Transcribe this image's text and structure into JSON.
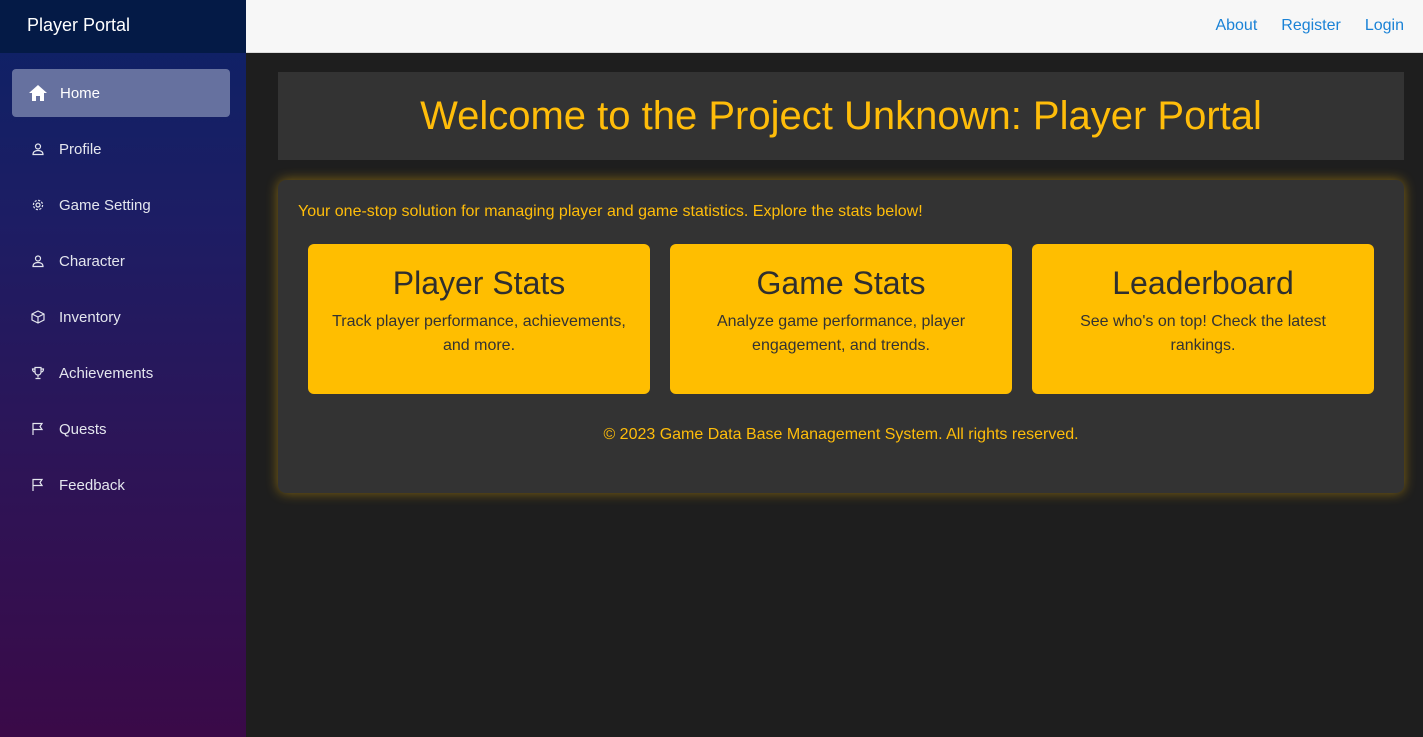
{
  "sidebar": {
    "brand": "Player Portal",
    "items": [
      {
        "label": "Home",
        "icon": "home-icon",
        "active": true
      },
      {
        "label": "Profile",
        "icon": "person-icon"
      },
      {
        "label": "Game Setting",
        "icon": "gear-icon"
      },
      {
        "label": "Character",
        "icon": "person-icon"
      },
      {
        "label": "Inventory",
        "icon": "box-icon"
      },
      {
        "label": "Achievements",
        "icon": "trophy-icon"
      },
      {
        "label": "Quests",
        "icon": "flag-icon"
      },
      {
        "label": "Feedback",
        "icon": "flag-icon"
      }
    ]
  },
  "topbar": {
    "links": [
      "About",
      "Register",
      "Login"
    ]
  },
  "hero": {
    "title": "Welcome to the Project Unknown: Player Portal"
  },
  "main": {
    "intro": "Your one-stop solution for managing player and game statistics. Explore the stats below!",
    "cards": [
      {
        "title": "Player Stats",
        "description": "Track player performance, achievements, and more."
      },
      {
        "title": "Game Stats",
        "description": "Analyze game performance, player engagement, and trends."
      },
      {
        "title": "Leaderboard",
        "description": "See who's on top! Check the latest rankings."
      }
    ],
    "footer": "© 2023 Game Data Base Management System. All rights reserved."
  },
  "colors": {
    "accent": "#ffbe00",
    "link": "#1a82d6",
    "panel": "#333333"
  }
}
